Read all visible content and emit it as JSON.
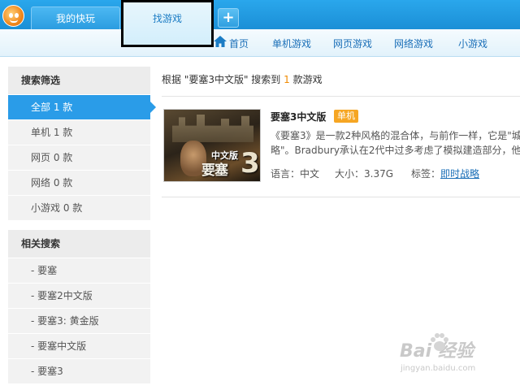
{
  "tabs": {
    "favorites": "我的快玩",
    "find_games": "找游戏",
    "add": "+"
  },
  "nav": {
    "home": "首页",
    "single": "单机游戏",
    "web": "网页游戏",
    "online": "网络游戏",
    "mini": "小游戏"
  },
  "sidebar": {
    "filter_title": "搜索筛选",
    "filters": [
      {
        "label": "全部 1 款"
      },
      {
        "label": "单机 1 款"
      },
      {
        "label": "网页 0 款"
      },
      {
        "label": "网络 0 款"
      },
      {
        "label": "小游戏 0 款"
      }
    ],
    "related_title": "相关搜索",
    "related": [
      {
        "label": "- 要塞"
      },
      {
        "label": "- 要塞2中文版"
      },
      {
        "label": "- 要塞3: 黄金版"
      },
      {
        "label": "- 要塞中文版"
      },
      {
        "label": "- 要塞3"
      }
    ]
  },
  "results": {
    "summary_prefix": "根据 \"要塞3中文版\" 搜索到",
    "count": "1",
    "summary_suffix": "款游戏",
    "items": [
      {
        "title": "要塞3中文版",
        "badge": "单机",
        "thumb_cn": "中文版",
        "thumb_logo": "要塞",
        "thumb_num": "3",
        "desc_line1": "《要塞3》是一款2种风格的混合体，与前作一样，它是\"城",
        "desc_line2": "略\"。Bradbury承认在2代中过多考虑了模拟建造部分，他",
        "language": "语言：中文",
        "size": "大小：3.37G",
        "tag_label": "标签：",
        "tag_link": "即时战略"
      }
    ]
  },
  "watermark": {
    "brand": "Bai 经验",
    "url": "jingyan.baidu.com"
  },
  "colors": {
    "accent": "#2a9ce8",
    "tab_bar": "#1b8fd6",
    "badge": "#f6a623",
    "count": "#f08a00",
    "link": "#1b6fb8"
  },
  "icons": {
    "logo": "kuaiwan-logo",
    "home": "home-icon"
  }
}
